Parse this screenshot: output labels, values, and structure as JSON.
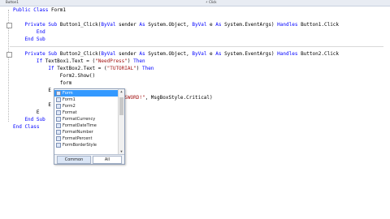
{
  "top_bar": {
    "left_dropdown": "Button1",
    "right_dropdown": "Click"
  },
  "code": {
    "lines": [
      {
        "segments": [
          {
            "t": "Public Class ",
            "k": "kw"
          },
          {
            "t": "Form1",
            "k": ""
          }
        ]
      },
      {
        "segments": [
          {
            "t": "",
            "k": ""
          }
        ]
      },
      {
        "segments": [
          {
            "t": "    Private Sub ",
            "k": "kw"
          },
          {
            "t": "Button1_Click(",
            "k": ""
          },
          {
            "t": "ByVal",
            "k": "kw"
          },
          {
            "t": " sender ",
            "k": ""
          },
          {
            "t": "As",
            "k": "kw"
          },
          {
            "t": " System.Object, ",
            "k": ""
          },
          {
            "t": "ByVal",
            "k": "kw"
          },
          {
            "t": " e ",
            "k": ""
          },
          {
            "t": "As",
            "k": "kw"
          },
          {
            "t": " System.EventArgs) ",
            "k": ""
          },
          {
            "t": "Handles",
            "k": "kw"
          },
          {
            "t": " Button1.Click",
            "k": ""
          }
        ]
      },
      {
        "segments": [
          {
            "t": "        End",
            "k": "kw"
          }
        ]
      },
      {
        "segments": [
          {
            "t": "    End Sub",
            "k": "kw"
          }
        ]
      },
      {
        "segments": [
          {
            "t": "",
            "k": ""
          }
        ]
      },
      {
        "segments": [
          {
            "t": "    Private Sub ",
            "k": "kw"
          },
          {
            "t": "Button2_Click(",
            "k": ""
          },
          {
            "t": "ByVal",
            "k": "kw"
          },
          {
            "t": " sender ",
            "k": ""
          },
          {
            "t": "As",
            "k": "kw"
          },
          {
            "t": " System.Object, ",
            "k": ""
          },
          {
            "t": "ByVal",
            "k": "kw"
          },
          {
            "t": " e ",
            "k": ""
          },
          {
            "t": "As",
            "k": "kw"
          },
          {
            "t": " System.EventArgs) ",
            "k": ""
          },
          {
            "t": "Handles",
            "k": "kw"
          },
          {
            "t": " Button2.Click",
            "k": ""
          }
        ]
      },
      {
        "segments": [
          {
            "t": "        If",
            "k": "kw"
          },
          {
            "t": " TextBox1.Text = (",
            "k": ""
          },
          {
            "t": "\"NeedPress\"",
            "k": "str"
          },
          {
            "t": ") ",
            "k": ""
          },
          {
            "t": "Then",
            "k": "kw"
          }
        ]
      },
      {
        "segments": [
          {
            "t": "            If",
            "k": "kw"
          },
          {
            "t": " TextBox2.Text = (",
            "k": ""
          },
          {
            "t": "\"TUTORIAL\"",
            "k": "str"
          },
          {
            "t": ") ",
            "k": ""
          },
          {
            "t": "Then",
            "k": "kw"
          }
        ]
      },
      {
        "segments": [
          {
            "t": "                Form2.Show()",
            "k": ""
          }
        ]
      },
      {
        "segments": [
          {
            "t": "                form",
            "k": ""
          }
        ]
      },
      {
        "segments": [
          {
            "t": "            E",
            "k": ""
          }
        ]
      },
      {
        "segments": [
          {
            "t": "                ",
            "k": ""
          },
          {
            "t": "\"WRONG USERNAME OR PASSWORD!\"",
            "k": "str"
          },
          {
            "t": ", MsgBoxStyle.Critical)",
            "k": ""
          }
        ]
      },
      {
        "segments": [
          {
            "t": "            E",
            "k": ""
          }
        ]
      },
      {
        "segments": [
          {
            "t": "        E",
            "k": ""
          }
        ]
      },
      {
        "segments": [
          {
            "t": "    End Sub",
            "k": "kw"
          }
        ]
      },
      {
        "segments": [
          {
            "t": "End Class",
            "k": "kw"
          }
        ]
      }
    ]
  },
  "intellisense": {
    "items": [
      "Form",
      "Form1",
      "Form2",
      "Format",
      "FormatCurrency",
      "FormatDateTime",
      "FormatNumber",
      "FormatPercent",
      "FormBorderStyle"
    ],
    "selected_index": 0,
    "tabs": [
      "Common",
      "All"
    ],
    "active_tab": "Common"
  }
}
